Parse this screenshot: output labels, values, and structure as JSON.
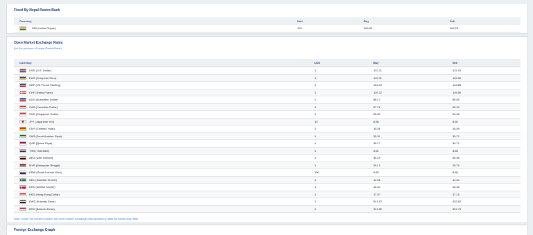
{
  "fixed": {
    "title": "Fixed By Nepal Rastra Bank",
    "columns": {
      "currency": "Currency",
      "unit": "Unit",
      "buy": "Buy",
      "sell": "Sell"
    },
    "row": {
      "currency": "INR (Indian Rupee)",
      "unit": "100",
      "buy": "160.00",
      "sell": "160.15",
      "flag": "india-flag"
    }
  },
  "open": {
    "title": "Open Market Exchange Rates",
    "subtitle": "(for the purpose of Nepal Rastra Bank)",
    "columns": {
      "currency": "Currency",
      "unit": "Unit",
      "buy": "Buy",
      "sell": "Sell"
    },
    "rows": [
      {
        "currency": "USD (U.S. Dollar)",
        "unit": "1",
        "buy": "131.11",
        "sell": "131.91",
        "flag": "usa-flag"
      },
      {
        "currency": "EUR (European Euro)",
        "unit": "1",
        "buy": "119.31",
        "sell": "119.86",
        "flag": "eu-flag"
      },
      {
        "currency": "GBP (UK Pound Sterling)",
        "unit": "1",
        "buy": "148.09",
        "sell": "148.85",
        "flag": "uk-flag"
      },
      {
        "currency": "CHF (Swiss Franc)",
        "unit": "1",
        "buy": "119.22",
        "sell": "119.89",
        "flag": "swiss-flag"
      },
      {
        "currency": "AUD (Australian Dollar)",
        "unit": "1",
        "buy": "88.12",
        "sell": "88.65",
        "flag": "australia-flag"
      },
      {
        "currency": "CAD (Canadian Dollar)",
        "unit": "1",
        "buy": "97.78",
        "sell": "98.23",
        "flag": "canada-flag"
      },
      {
        "currency": "SGD (Singapore Dollar)",
        "unit": "1",
        "buy": "98.82",
        "sell": "99.36",
        "flag": "singapore-flag"
      },
      {
        "currency": "JPY (Japanese Yen)",
        "unit": "10",
        "buy": "8.56",
        "sell": "8.60",
        "flag": "japan-flag"
      },
      {
        "currency": "CNY (Chinese Yuan)",
        "unit": "1",
        "buy": "18.56",
        "sell": "18.59",
        "flag": "china-flag"
      },
      {
        "currency": "SAR (Saudi Arabian Riyal)",
        "unit": "1",
        "buy": "35.31",
        "sell": "35.71",
        "flag": "saudi-flag"
      },
      {
        "currency": "QAR (Qatari Riyal)",
        "unit": "1",
        "buy": "36.17",
        "sell": "36.71",
        "flag": "qatar-flag"
      },
      {
        "currency": "THB (Thai Baht)",
        "unit": "1",
        "buy": "3.61",
        "sell": "3.66",
        "flag": "thailand-flag"
      },
      {
        "currency": "AED (UAE Dirham)",
        "unit": "1",
        "buy": "36.29",
        "sell": "36.98",
        "flag": "uae-flag"
      },
      {
        "currency": "MYR (Malaysian Ringgit)",
        "unit": "1",
        "buy": "28.12",
        "sell": "28.75",
        "flag": "malaysia-flag"
      },
      {
        "currency": "KRW (South Korean Won)",
        "unit": "100",
        "buy": "9.80",
        "sell": "9.85",
        "flag": "korea-flag"
      },
      {
        "currency": "SEK (Swedish Kroner)",
        "unit": "1",
        "buy": "12.56",
        "sell": "12.92",
        "flag": "sweden-flag"
      },
      {
        "currency": "DKK (Danish Kroner)",
        "unit": "1",
        "buy": "16.31",
        "sell": "16.35",
        "flag": "denmark-flag"
      },
      {
        "currency": "HKD (Hong Kong Dollar)",
        "unit": "1",
        "buy": "17.07",
        "sell": "17.15",
        "flag": "hongkong-flag"
      },
      {
        "currency": "KWD (Kuwaity Dinar)",
        "unit": "1",
        "buy": "513.87",
        "sell": "433.62",
        "flag": "kuwait-flag"
      },
      {
        "currency": "BHD (Bahrain Dinar)",
        "unit": "1",
        "buy": "313.80",
        "sell": "351.73",
        "flag": "bahrain-flag"
      }
    ],
    "note": "Note: Under the present system the open market exchange rates quoted by different banks may differ."
  },
  "graph": {
    "title": "Foreign Exchange Graph"
  },
  "flag_colors": {
    "india-flag": [
      "#ff9933",
      "#ffffff",
      "#138808"
    ],
    "usa-flag": [
      "#b22234",
      "#ffffff",
      "#3c3b6e"
    ],
    "eu-flag": [
      "#003399",
      "#ffcc00"
    ],
    "uk-flag": [
      "#012169",
      "#ffffff",
      "#c8102e"
    ],
    "swiss-flag": [
      "#d52b1e",
      "#ffffff"
    ],
    "australia-flag": [
      "#012169",
      "#ffffff",
      "#e4002b"
    ],
    "canada-flag": [
      "#d52b1e",
      "#ffffff"
    ],
    "singapore-flag": [
      "#ef3340",
      "#ffffff"
    ],
    "japan-flag": [
      "#ffffff",
      "#bc002d"
    ],
    "china-flag": [
      "#de2910",
      "#ffde00"
    ],
    "saudi-flag": [
      "#006c35",
      "#ffffff"
    ],
    "qatar-flag": [
      "#8a1538",
      "#ffffff"
    ],
    "thailand-flag": [
      "#a51931",
      "#f4f5f8",
      "#2d2a4a"
    ],
    "uae-flag": [
      "#00732f",
      "#ffffff",
      "#000000",
      "#ff0000"
    ],
    "malaysia-flag": [
      "#cc0001",
      "#ffffff",
      "#010066",
      "#ffcc00"
    ],
    "korea-flag": [
      "#ffffff",
      "#c60c30",
      "#003478"
    ],
    "sweden-flag": [
      "#006aa7",
      "#fecc00"
    ],
    "denmark-flag": [
      "#c60c30",
      "#ffffff"
    ],
    "hongkong-flag": [
      "#de2910",
      "#ffffff"
    ],
    "kuwait-flag": [
      "#007a3d",
      "#ffffff",
      "#ce1126",
      "#000000"
    ],
    "bahrain-flag": [
      "#ce1126",
      "#ffffff"
    ]
  }
}
